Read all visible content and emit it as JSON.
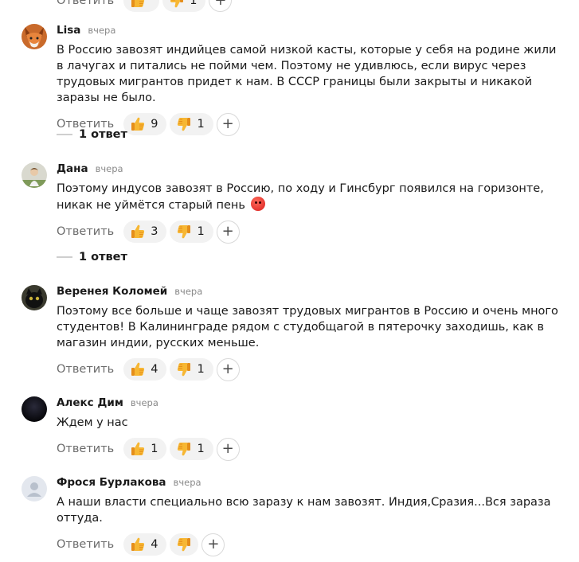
{
  "top_stub": {
    "reply_label": "Ответить",
    "likes": "",
    "dislikes": "1"
  },
  "comments": [
    {
      "author": "Lisa",
      "time": "вчера",
      "text": "В Россию завозят индийцев самой низкой касты, которые у себя на родине жили в лачугах и питались не пойми чем. Поэтому не удивлюсь, если вирус через трудовых мигрантов придет к нам. В СССР границы были закрыты и никакой заразы не было.",
      "reply_label": "Ответить",
      "likes": "9",
      "dislikes": "1",
      "replies": "1 ответ"
    },
    {
      "author": "Дана",
      "time": "вчера",
      "text": "Поэтому индусов завозят в Россию, по ходу и Гинсбург появился на горизонте, никак не уймётся старый пень",
      "reply_label": "Ответить",
      "likes": "3",
      "dislikes": "1",
      "replies": "1 ответ"
    },
    {
      "author": "Веренея Коломей",
      "time": "вчера",
      "text": "Поэтому все больше и чаще завозят трудовых мигрантов в Россию и очень много студентов! В Калининграде рядом с студобщагой в пятерочку заходишь, как в магазин индии, русских меньше.",
      "reply_label": "Ответить",
      "likes": "4",
      "dislikes": "1"
    },
    {
      "author": "Алекс Дим",
      "time": "вчера",
      "text": "Ждем у нас",
      "reply_label": "Ответить",
      "likes": "1",
      "dislikes": "1"
    },
    {
      "author": "Фрося Бурлакова",
      "time": "вчера",
      "text": "А наши власти специально всю заразу к нам завозят. Индия,Сразия...Вся зараза оттуда.",
      "reply_label": "Ответить",
      "likes": "4",
      "dislikes": ""
    }
  ],
  "icons": {
    "like": "thumbs-up-icon",
    "dislike": "thumbs-down-icon",
    "add": "plus-icon",
    "angry": "angry-face-icon"
  },
  "colors": {
    "pill_bg": "#f2f2f2",
    "muted": "#6b6b6b",
    "like": "#f5a623"
  }
}
